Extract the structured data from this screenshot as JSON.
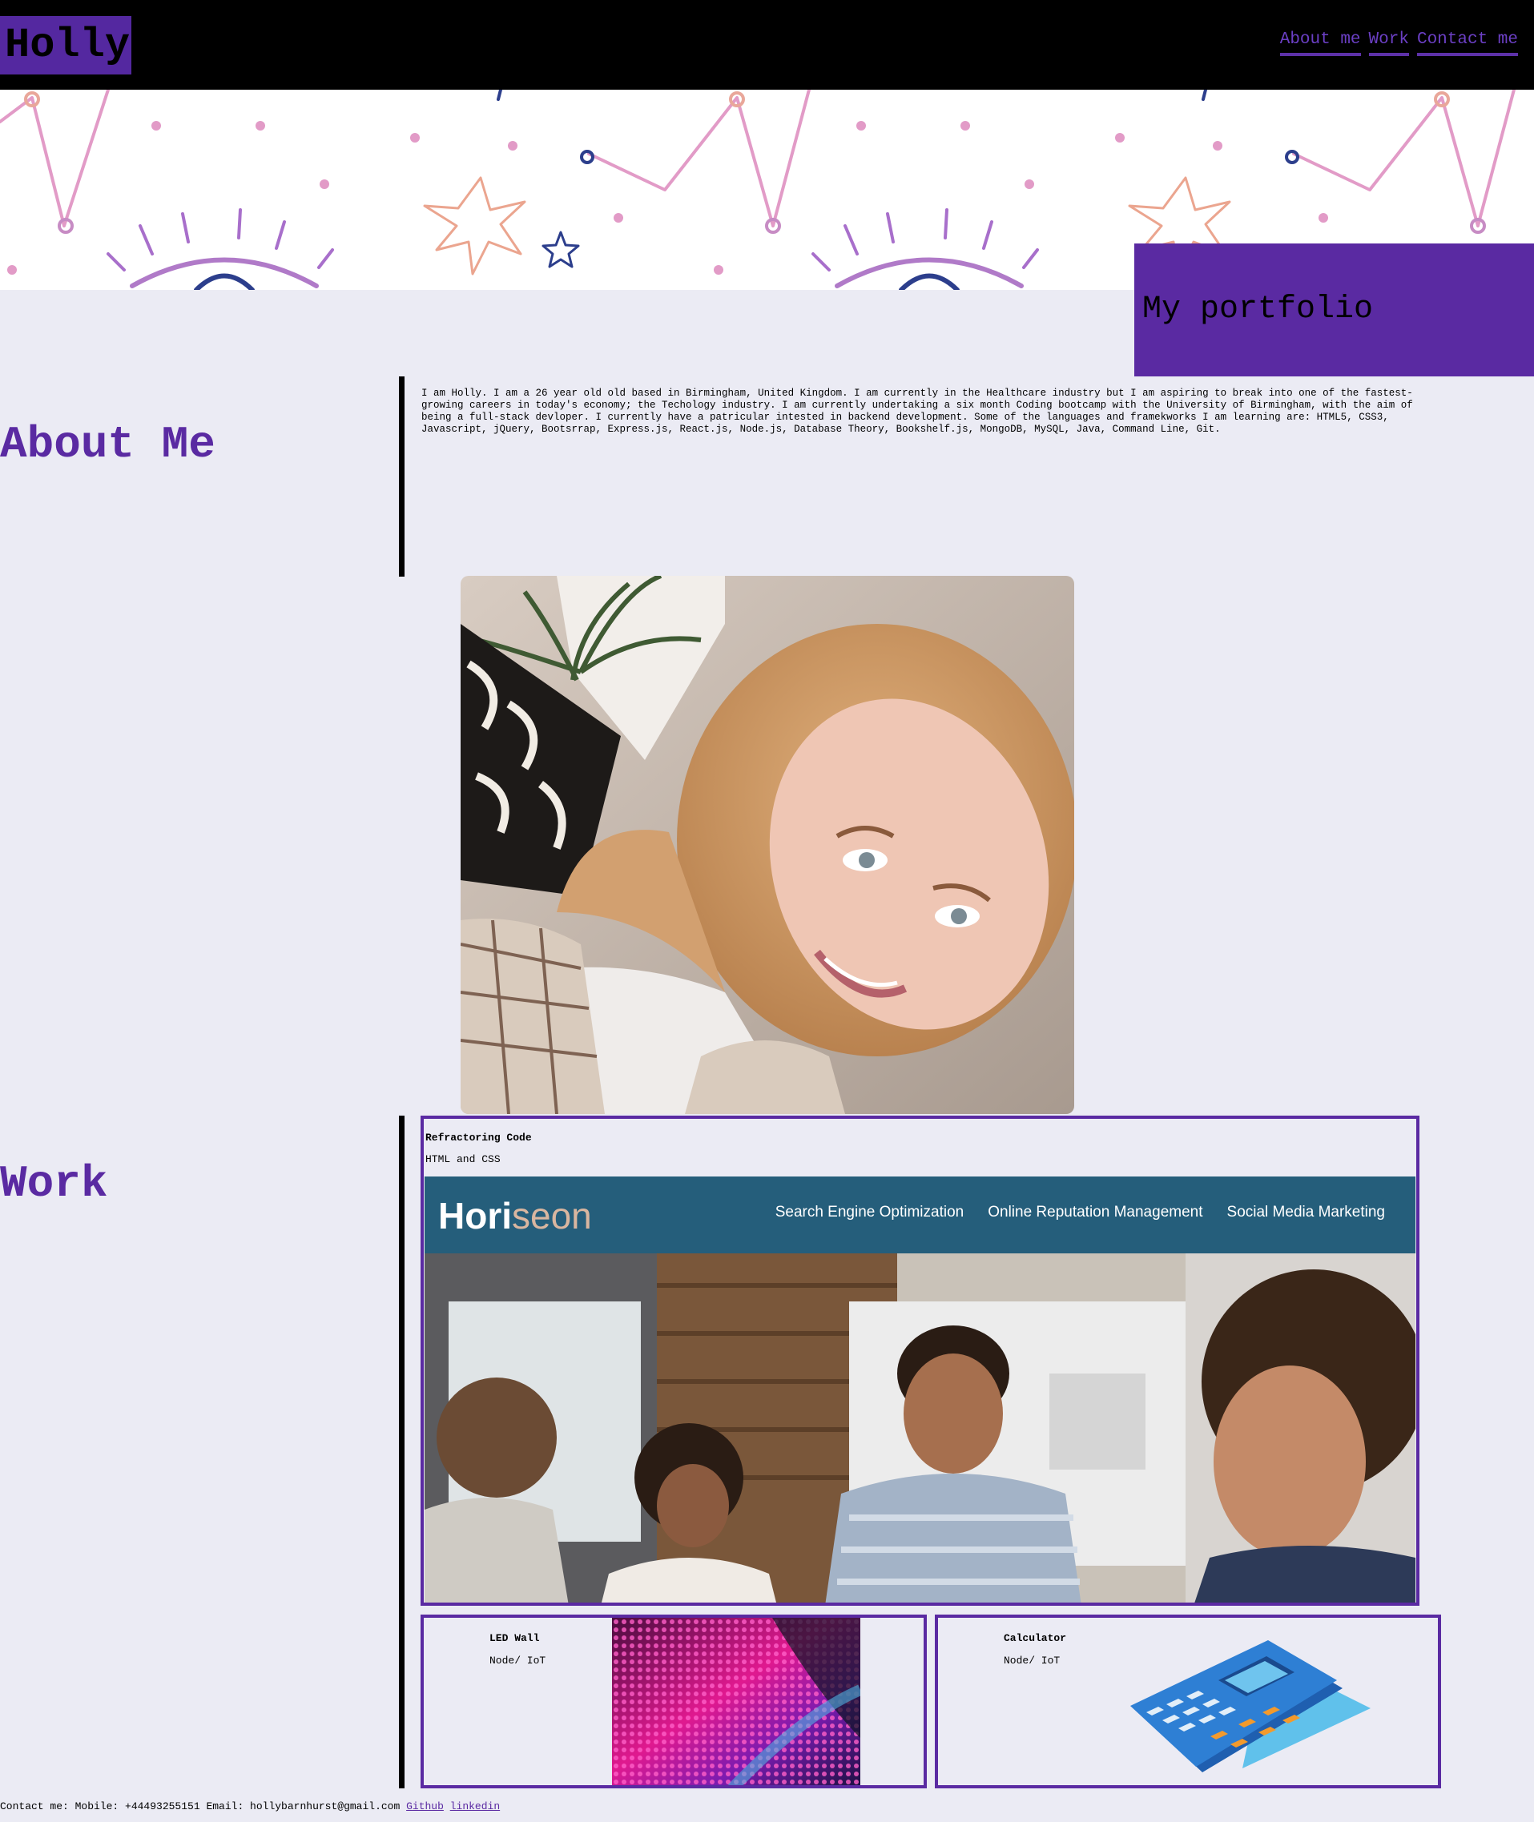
{
  "header": {
    "logo": "Holly",
    "nav": [
      "About me",
      "Work",
      "Contact me"
    ]
  },
  "hero": {
    "banner_title": "My portfolio"
  },
  "about": {
    "title": "About Me",
    "text": "I am Holly. I am a 26 year old old based in Birmingham, United Kingdom. I am currently in the Healthcare industry but I am aspiring to break into one of the fastest-growing careers in today's economy; the Techology industry. I am currently undertaking a six month Coding bootcamp with the University of Birmingham, with the aim of being a full-stack devloper. I currently have a patricular intested in backend development. Some of the languages and framekworks I am learning are: HTML5, CSS3, Javascript, jQuery, Bootsrrap, Express.js, React.js, Node.js, Database Theory, Bookshelf.js, MongoDB, MySQL, Java, Command Line, Git."
  },
  "work": {
    "title": "Work",
    "projects": [
      {
        "title": "Refractoring Code",
        "subtitle": "HTML and CSS",
        "screenshot": {
          "brand": "Horiseon",
          "nav": [
            "Search Engine Optimization",
            "Online Reputation Management",
            "Social Media Marketing"
          ]
        }
      },
      {
        "title": "LED Wall",
        "subtitle": "Node/ IoT"
      },
      {
        "title": "Calculator",
        "subtitle": "Node/ IoT"
      }
    ]
  },
  "footer": {
    "contact": "Contact me: Mobile: +44493255151 Email: hollybarnhurst@gmail.com",
    "links": [
      "Github",
      "linkedin"
    ]
  },
  "colors": {
    "accent": "#5a2aa2",
    "background": "#ebebf4",
    "header": "#000000",
    "horiseon_bar": "#255e7b"
  }
}
